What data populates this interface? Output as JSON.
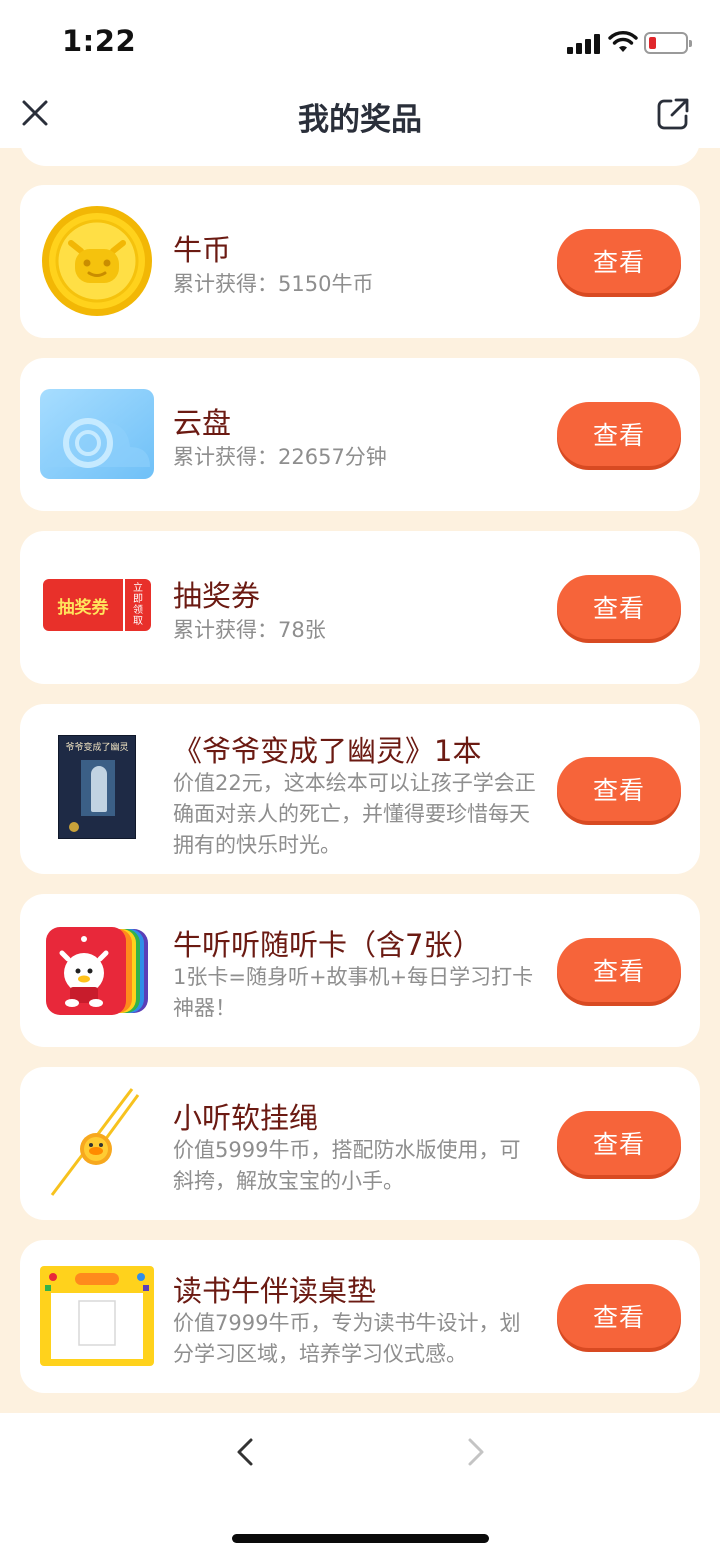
{
  "status_bar": {
    "time": "1:22",
    "battery_color": "#e0262b"
  },
  "nav": {
    "title": "我的奖品",
    "close_icon": "close-icon",
    "share_icon": "share-external-icon"
  },
  "colors": {
    "page_background": "#fdf1df",
    "button": "#f6643a",
    "title_text": "#6b1a12",
    "desc_text": "#8e8e8e"
  },
  "prizes": [
    {
      "icon": "gold-coin-icon",
      "title": "牛币",
      "desc": "累计获得：5150牛币",
      "button": "查看"
    },
    {
      "icon": "cloud-disk-icon",
      "title": "云盘",
      "desc": "累计获得：22657分钟",
      "button": "查看"
    },
    {
      "icon": "lottery-ticket-icon",
      "ticket_label": "抽奖券",
      "ticket_stub": "立即领取",
      "title": "抽奖券",
      "desc": "累计获得：78张",
      "button": "查看"
    },
    {
      "icon": "book-cover-icon",
      "book_cover_text": "爷爷变成了幽灵",
      "title": "《爷爷变成了幽灵》1本",
      "desc": "价值22元，这本绘本可以让孩子学会正确面对亲人的死亡，并懂得要珍惜每天拥有的快乐时光。",
      "button": "查看"
    },
    {
      "icon": "listening-cards-icon",
      "title": "牛听听随听卡（含7张）",
      "desc": "1张卡=随身听+故事机+每日学习打卡神器！",
      "button": "查看"
    },
    {
      "icon": "lanyard-icon",
      "title": "小听软挂绳",
      "desc": "价值5999牛币，搭配防水版使用，可斜挎，解放宝宝的小手。",
      "button": "查看"
    },
    {
      "icon": "desk-mat-icon",
      "title": "读书牛伴读桌垫",
      "desc": "价值7999牛币，专为读书牛设计，划分学习区域，培养学习仪式感。",
      "button": "查看"
    }
  ],
  "bottom_bar": {
    "back_icon": "chevron-left-icon",
    "forward_icon": "chevron-right-icon"
  }
}
